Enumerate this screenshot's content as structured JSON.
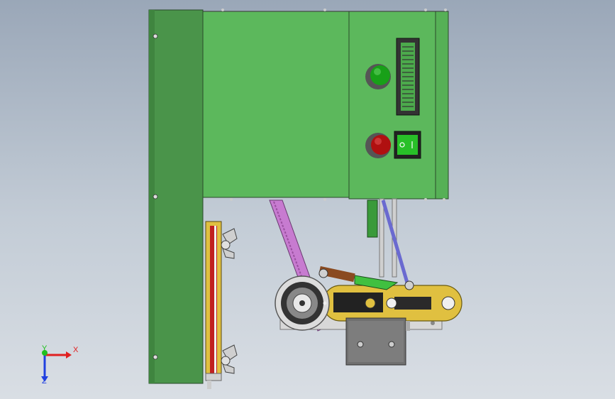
{
  "viewport": {
    "background_top": "#9aa7b8",
    "background_bottom": "#d9dee4"
  },
  "model": {
    "panel_color": "#5cb85c",
    "panel_dark_color": "#4a9a4a",
    "frame_color": "#c8c8c8",
    "belt_color": "#c77bd0",
    "arm_color": "#e0c040",
    "rod_color": "#6a6ad0",
    "parts": {
      "green_button": "green-pushbutton",
      "red_button": "red-pushbutton",
      "display": "lcd-display",
      "switch": "rocker-switch",
      "pulley": "pulley-wheel",
      "motor": "motor-block",
      "wing_nut_top": "wing-nut",
      "wing_nut_bottom": "wing-nut"
    }
  },
  "triad": {
    "x_label": "X",
    "y_label": "Y",
    "z_label": "Z",
    "x_color": "#e02020",
    "y_color": "#20c020",
    "z_color": "#2040e0"
  }
}
